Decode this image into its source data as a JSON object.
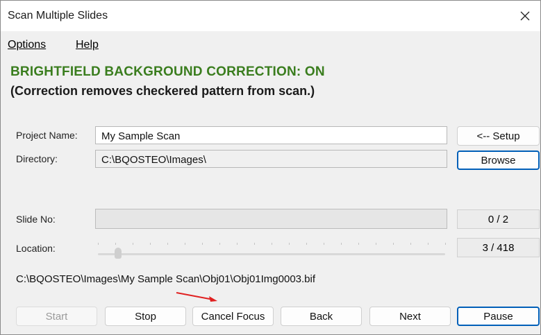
{
  "window": {
    "title": "Scan Multiple Slides",
    "close_glyph": "✕"
  },
  "menu": {
    "items": [
      "Options",
      "Help"
    ]
  },
  "status": {
    "title": "BRIGHTFIELD BACKGROUND CORRECTION: ON",
    "subtitle": "(Correction removes checkered pattern from scan.)",
    "title_color": "#3a7d1e"
  },
  "form": {
    "project_label": "Project Name:",
    "project_value": "My Sample Scan",
    "directory_label": "Directory:",
    "directory_value": "C:\\BQOSTEO\\Images\\",
    "setup_button": "<-- Setup",
    "browse_button": "Browse"
  },
  "progress": {
    "slide_label": "Slide No:",
    "slide_counter": "0 / 2",
    "slide_progress": 0,
    "location_label": "Location:",
    "location_counter": "3 / 418",
    "location_current": 3,
    "location_total": 418
  },
  "current_file": "C:\\BQOSTEO\\Images\\My Sample Scan\\Obj01\\Obj01Img0003.bif",
  "buttons": {
    "start": "Start",
    "stop": "Stop",
    "cancel_focus": "Cancel Focus",
    "back": "Back",
    "next": "Next",
    "pause": "Pause"
  },
  "colors": {
    "accent": "#005fb8",
    "annotation_arrow": "#e02020"
  },
  "icons": {
    "close": "close-icon"
  }
}
